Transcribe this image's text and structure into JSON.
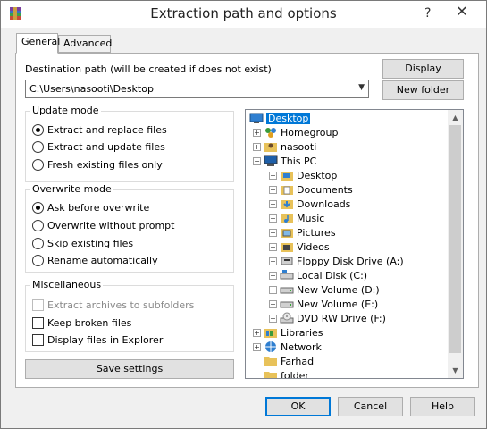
{
  "window": {
    "title": "Extraction path and options",
    "help_glyph": "?",
    "close_glyph": "✕"
  },
  "tabs": [
    {
      "label": "General",
      "active": true
    },
    {
      "label": "Advanced",
      "active": false
    }
  ],
  "destination": {
    "label": "Destination path (will be created if does not exist)",
    "value": "C:\\Users\\nasooti\\Desktop"
  },
  "buttons": {
    "display": "Display",
    "new_folder": "New folder",
    "save_settings": "Save settings",
    "ok": "OK",
    "cancel": "Cancel",
    "help": "Help"
  },
  "update_mode": {
    "title": "Update mode",
    "options": [
      {
        "label": "Extract and replace files",
        "selected": true
      },
      {
        "label": "Extract and update files",
        "selected": false
      },
      {
        "label": "Fresh existing files only",
        "selected": false
      }
    ]
  },
  "overwrite_mode": {
    "title": "Overwrite mode",
    "options": [
      {
        "label": "Ask before overwrite",
        "selected": true
      },
      {
        "label": "Overwrite without prompt",
        "selected": false
      },
      {
        "label": "Skip existing files",
        "selected": false
      },
      {
        "label": "Rename automatically",
        "selected": false
      }
    ]
  },
  "miscellaneous": {
    "title": "Miscellaneous",
    "options": [
      {
        "label": "Extract archives to subfolders",
        "checked": false,
        "disabled": true
      },
      {
        "label": "Keep broken files",
        "checked": false,
        "disabled": false
      },
      {
        "label": "Display files in Explorer",
        "checked": false,
        "disabled": false
      }
    ]
  },
  "tree": {
    "items": [
      {
        "label": "Desktop",
        "icon": "desktop-icon",
        "selected": true
      },
      {
        "label": "Homegroup",
        "icon": "homegroup-icon",
        "selected": false
      },
      {
        "label": "nasooti",
        "icon": "user-folder-icon",
        "selected": false
      },
      {
        "label": "This PC",
        "icon": "computer-icon",
        "selected": false
      },
      {
        "label": "Desktop",
        "icon": "desktop-folder-icon",
        "selected": false
      },
      {
        "label": "Documents",
        "icon": "documents-icon",
        "selected": false
      },
      {
        "label": "Downloads",
        "icon": "downloads-icon",
        "selected": false
      },
      {
        "label": "Music",
        "icon": "music-icon",
        "selected": false
      },
      {
        "label": "Pictures",
        "icon": "pictures-icon",
        "selected": false
      },
      {
        "label": "Videos",
        "icon": "videos-icon",
        "selected": false
      },
      {
        "label": "Floppy Disk Drive (A:)",
        "icon": "floppy-drive-icon",
        "selected": false
      },
      {
        "label": "Local Disk (C:)",
        "icon": "local-disk-icon",
        "selected": false
      },
      {
        "label": "New Volume (D:)",
        "icon": "drive-icon",
        "selected": false
      },
      {
        "label": "New Volume (E:)",
        "icon": "drive-icon",
        "selected": false
      },
      {
        "label": "DVD RW Drive (F:)",
        "icon": "dvd-drive-icon",
        "selected": false
      },
      {
        "label": "Libraries",
        "icon": "libraries-icon",
        "selected": false
      },
      {
        "label": "Network",
        "icon": "network-icon",
        "selected": false
      },
      {
        "label": "Farhad",
        "icon": "folder-icon",
        "selected": false
      },
      {
        "label": "folder",
        "icon": "folder-icon",
        "selected": false
      }
    ]
  },
  "colors": {
    "selection": "#0078d7",
    "folder": "#e8c25a",
    "default_button_border": "#0078d7"
  }
}
